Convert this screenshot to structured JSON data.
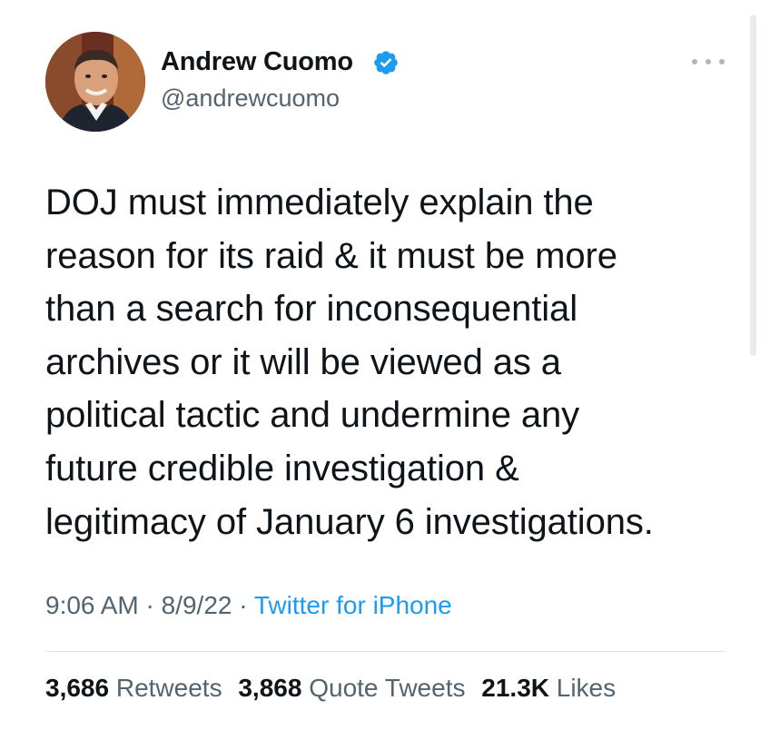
{
  "author": {
    "display_name": "Andrew Cuomo",
    "handle": "@andrewcuomo",
    "verified": true,
    "avatar_icon": "profile-photo"
  },
  "menu": {
    "icon": "more-options-icon"
  },
  "tweet": {
    "text": "DOJ must immediately explain the\nreason for its raid & it must be more\nthan a search for inconsequential\narchives or it will be viewed as a\npolitical tactic and undermine any\nfuture credible investigation &\nlegitimacy of January 6 investigations.",
    "time": "9:06 AM",
    "separator": " · ",
    "date": "8/9/22",
    "source": "Twitter for iPhone"
  },
  "stats": {
    "retweets_count": "3,686",
    "retweets_label": "Retweets",
    "quotes_count": "3,868",
    "quotes_label": "Quote Tweets",
    "likes_count": "21.3K",
    "likes_label": "Likes"
  },
  "colors": {
    "text": "#0f1419",
    "secondary": "#536471",
    "link": "#1d9bf0",
    "verified": "#1d9bf0",
    "divider": "#dfe3e6"
  }
}
